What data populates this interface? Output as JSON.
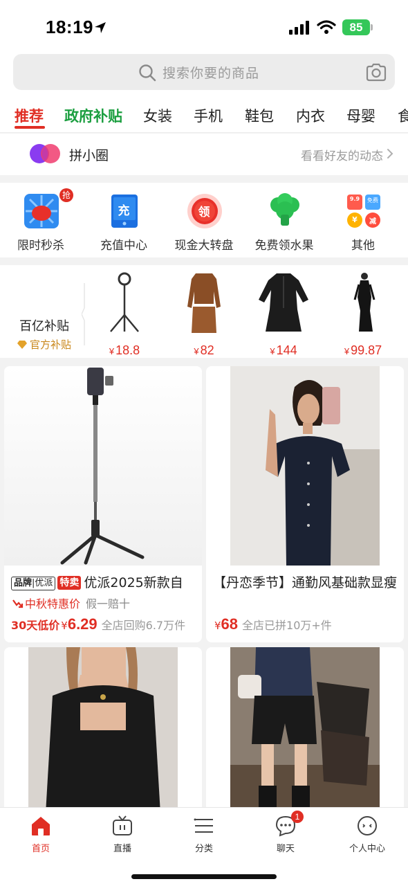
{
  "status": {
    "time": "18:19",
    "battery": "85"
  },
  "search": {
    "placeholder": "搜索你要的商品"
  },
  "tabs": [
    {
      "label": "推荐"
    },
    {
      "label": "政府补贴"
    },
    {
      "label": "女装"
    },
    {
      "label": "手机"
    },
    {
      "label": "鞋包"
    },
    {
      "label": "内衣"
    },
    {
      "label": "母婴"
    },
    {
      "label": "食"
    }
  ],
  "pin": {
    "title": "拼小圈",
    "subtitle": "看看好友的动态"
  },
  "quick": [
    {
      "label": "限时秒杀",
      "icon": "flash-sale-icon",
      "badge": "抢"
    },
    {
      "label": "充值中心",
      "icon": "recharge-icon",
      "glyph": "充"
    },
    {
      "label": "现金大转盘",
      "icon": "cash-wheel-icon",
      "glyph": "领"
    },
    {
      "label": "免费领水果",
      "icon": "free-fruit-icon"
    },
    {
      "label": "其他",
      "icon": "more-icon",
      "mini": [
        "9.9",
        "免费",
        "¥",
        "减"
      ]
    }
  ],
  "subsidy": {
    "title": "百亿补贴",
    "badge": "官方补贴",
    "items": [
      {
        "price": "18.8",
        "currency": "¥"
      },
      {
        "price": "82",
        "currency": "¥"
      },
      {
        "price": "144",
        "currency": "¥"
      },
      {
        "price": "99.87",
        "currency": "¥"
      }
    ]
  },
  "products": [
    {
      "tag_brand_a": "品牌",
      "tag_brand_b": "优派",
      "tag_sale": "特卖",
      "title": "优派2025新款自",
      "promo": "中秋特惠价",
      "promo_extra": "假一赔十",
      "low_label": "30天低价",
      "currency": "¥",
      "price": "6.29",
      "sold": "全店回购6.7万件"
    },
    {
      "title": "【丹恋季节】通勤风基础款显瘦",
      "currency": "¥",
      "price": "68",
      "sold": "全店已拼10万+件"
    }
  ],
  "nav": [
    {
      "label": "首页",
      "icon": "home-icon"
    },
    {
      "label": "直播",
      "icon": "live-tv-icon"
    },
    {
      "label": "分类",
      "icon": "category-list-icon"
    },
    {
      "label": "聊天",
      "icon": "chat-icon",
      "badge": "1"
    },
    {
      "label": "个人中心",
      "icon": "profile-icon"
    }
  ],
  "colors": {
    "accent": "#e02e24",
    "gov_green": "#1a9e3f",
    "battery_green": "#34c759",
    "subsidy_gold": "#c9871a"
  }
}
